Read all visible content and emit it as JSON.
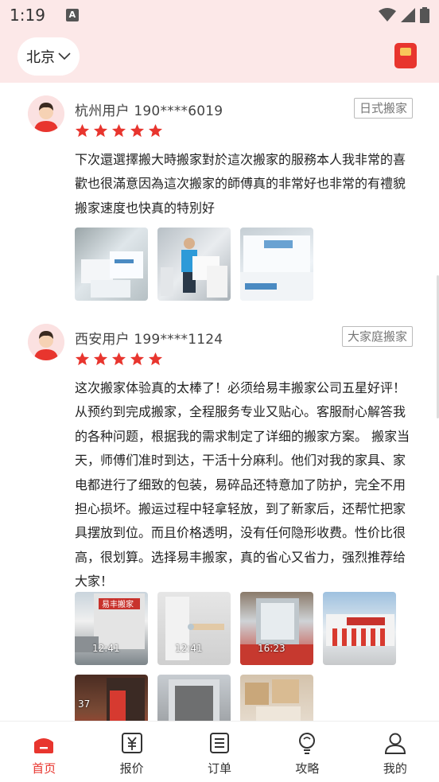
{
  "status": {
    "time": "1:19",
    "app_icon": "A"
  },
  "header": {
    "city": "北京"
  },
  "reviews": [
    {
      "user": "杭州用户 190****6019",
      "tag": "日式搬家",
      "text": "下次還選擇搬大時搬家對於這次搬家的服務本人我非常的喜歡也很滿意因為這次搬家的師傅真的非常好也非常的有禮貌搬家速度也快真的特別好",
      "rating": 5,
      "photos": [
        "photo-boxes",
        "photo-worker",
        "photo-boxes-close"
      ]
    },
    {
      "user": "西安用户 199****1124",
      "tag": "大家庭搬家",
      "text": "这次搬家体验真的太棒了！必须给易丰搬家公司五星好评！从预约到完成搬家，全程服务专业又贴心。客服耐心解答我的各种问题，根据我的需求制定了详细的搬家方案。 搬家当天，师傅们准时到达，干活十分麻利。他们对我的家具、家电都进行了细致的包装，易碎品还特意加了防护，完全不用担心损坏。搬运过程中轻拿轻放，到了新家后，还帮忙把家具摆放到位。而且价格透明，没有任何隐形收费。性价比很高，很划算。选择易丰搬家，真的省心又省力，强烈推荐给大家！",
      "rating": 5,
      "photo_times": [
        "12:41",
        "12:41",
        "16:23",
        "",
        "37",
        "",
        ""
      ],
      "truck_brand": "易丰搬家"
    }
  ],
  "tabs": [
    {
      "label": "首页",
      "icon": "home-icon",
      "active": true
    },
    {
      "label": "报价",
      "icon": "price-icon",
      "active": false
    },
    {
      "label": "订单",
      "icon": "order-icon",
      "active": false
    },
    {
      "label": "攻略",
      "icon": "guide-icon",
      "active": false
    },
    {
      "label": "我的",
      "icon": "profile-icon",
      "active": false
    }
  ],
  "colors": {
    "accent": "#e8352e",
    "header_bg": "#fce8e8",
    "star": "#e8352e"
  }
}
